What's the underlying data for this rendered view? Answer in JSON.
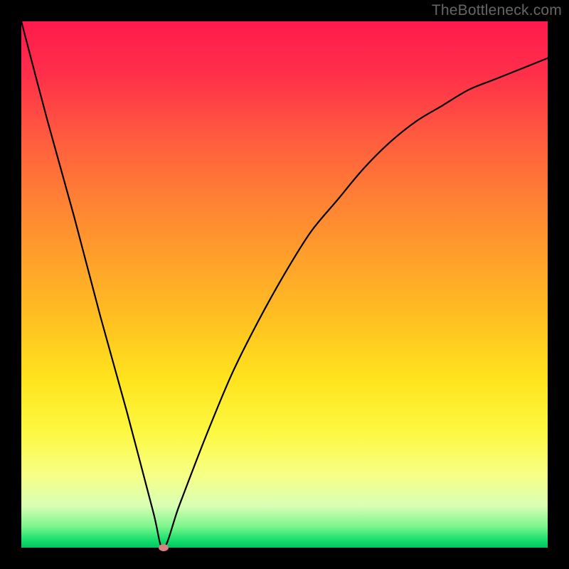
{
  "watermark": "TheBottleneck.com",
  "chart_data": {
    "type": "line",
    "title": "",
    "xlabel": "",
    "ylabel": "",
    "xlim": [
      0,
      100
    ],
    "ylim": [
      0,
      100
    ],
    "grid": false,
    "legend": false,
    "series": [
      {
        "name": "bottleneck-curve",
        "x": [
          0,
          5,
          10,
          15,
          20,
          25,
          27,
          30,
          35,
          40,
          45,
          50,
          55,
          60,
          65,
          70,
          75,
          80,
          85,
          90,
          95,
          100
        ],
        "values": [
          100,
          81,
          63,
          44,
          26,
          7,
          0,
          8,
          21,
          33,
          43,
          52,
          60,
          66,
          72,
          77,
          81,
          84,
          87,
          89,
          91,
          93
        ]
      }
    ],
    "annotations": [
      {
        "name": "minimum-marker",
        "x": 27,
        "y": 0,
        "color": "#d98082"
      }
    ],
    "background": {
      "type": "vertical-gradient",
      "stops": [
        {
          "pos": 0,
          "color": "#ff1a4d"
        },
        {
          "pos": 50,
          "color": "#ffb327"
        },
        {
          "pos": 80,
          "color": "#fdf840"
        },
        {
          "pos": 100,
          "color": "#00c45e"
        }
      ]
    }
  }
}
